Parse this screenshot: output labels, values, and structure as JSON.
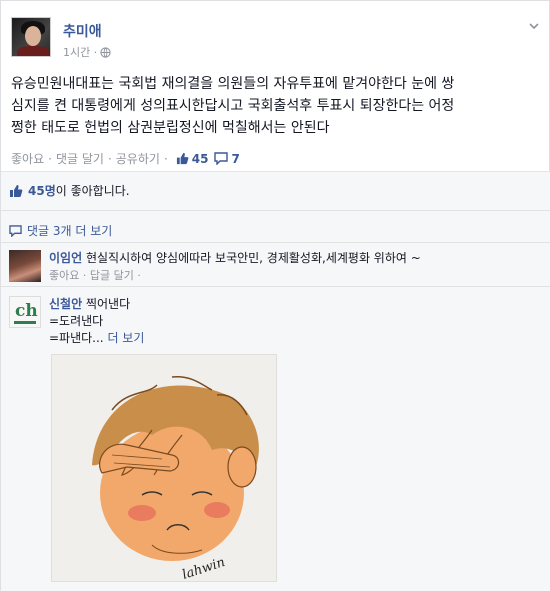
{
  "post": {
    "author": "추미애",
    "time": "1시간 ·",
    "text_line1": "유승민원내대표는 국회법 재의결을 의원들의 자유투표에 맡겨야한다 눈에 쌍",
    "text_line2": "심지를 켠 대통령에게 성의표시한답시고 국회출석후 투표시 퇴장한다는 어정",
    "text_line3": "쩡한 태도로 헌법의 삼권분립정신에 먹칠해서는 안된다",
    "actions": {
      "like": "좋아요",
      "comment": "댓글 달기",
      "share": "공유하기",
      "like_count": "45",
      "comment_count": "7"
    }
  },
  "ufi": {
    "likes_count": "45명",
    "likes_suffix": "이 좋아합니다.",
    "view_more_comments": "댓글 3개 더 보기"
  },
  "comments": [
    {
      "name": "이임언",
      "text": "현실직시하여 양심에따라 보국안민, 경제활성화,세계평화 위하여 ~",
      "like": "좋아요",
      "reply": "답글 달기"
    },
    {
      "name": "신철안",
      "line1": "찍어낸다",
      "line2": "=도려낸다",
      "line3": "=파낸다...",
      "more": "더 보기",
      "avatar_text": "ch",
      "drawing_signature": "lahwin"
    }
  ],
  "colors": {
    "link": "#3b5998",
    "meta": "#90949c",
    "background": "#f6f7f9"
  },
  "icons": [
    "globe-icon",
    "chevron-down-icon",
    "thumbs-up-icon",
    "comment-bubble-icon"
  ]
}
